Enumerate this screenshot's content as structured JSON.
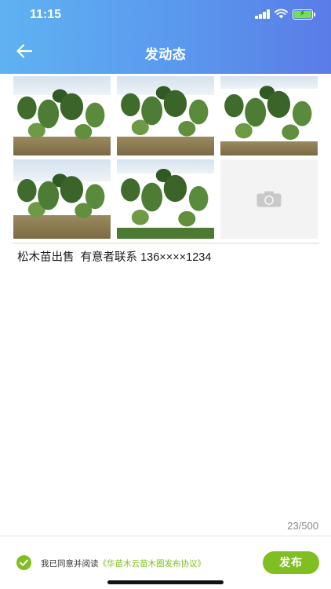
{
  "status_bar": {
    "time": "11:15"
  },
  "header": {
    "title": "发动态",
    "back_icon": "arrow-left-icon",
    "gradient": [
      "#5fb2f2",
      "#5a7ce6"
    ]
  },
  "photos": [
    {
      "label": "pine-saplings-photo-1"
    },
    {
      "label": "pine-saplings-photo-2"
    },
    {
      "label": "pine-saplings-photo-3"
    },
    {
      "label": "pine-saplings-photo-4"
    },
    {
      "label": "pine-saplings-photo-5"
    }
  ],
  "add_photo": {
    "icon": "camera-icon"
  },
  "post": {
    "text": "松木苗出售  有意者联系 136××××1234",
    "char_count": "23/500"
  },
  "footer": {
    "agree_text": "我已同意并阅读",
    "agreement_link": "《华苗木云苗木圈发布协议》",
    "publish_label": "发布",
    "accent": "#80bf21"
  }
}
